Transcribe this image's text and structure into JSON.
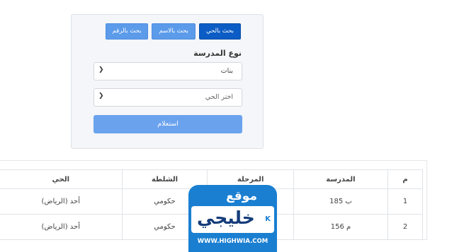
{
  "search": {
    "tabs": [
      {
        "label": "بحث بالحي",
        "active": true
      },
      {
        "label": "بحث بالاسم",
        "active": false
      },
      {
        "label": "بحث بالرقم",
        "active": false
      }
    ],
    "school_type_label": "نوع المدرسة",
    "school_type_value": "بنات",
    "district_value": "اختر الحي",
    "submit_label": "استعلام"
  },
  "results": {
    "headers": [
      "م",
      "المدرسة",
      "المرحلة",
      "الشلطة",
      "الحي"
    ],
    "rows": [
      [
        "1",
        "ب 185",
        "",
        "حكومي",
        "أحد (الرياض)"
      ],
      [
        "2",
        "م 156",
        "",
        "حكومي",
        "أحد (الرياض)"
      ]
    ]
  },
  "watermark": {
    "line1": "موقع",
    "line2": "خليجي",
    "line3": "WWW.HIGHWIA.COM"
  },
  "colors": {
    "tab_active": "#0b5cc4",
    "tab": "#5b9bea",
    "submit": "#6aa2ee",
    "watermark_blue": "#1a7fd1"
  }
}
